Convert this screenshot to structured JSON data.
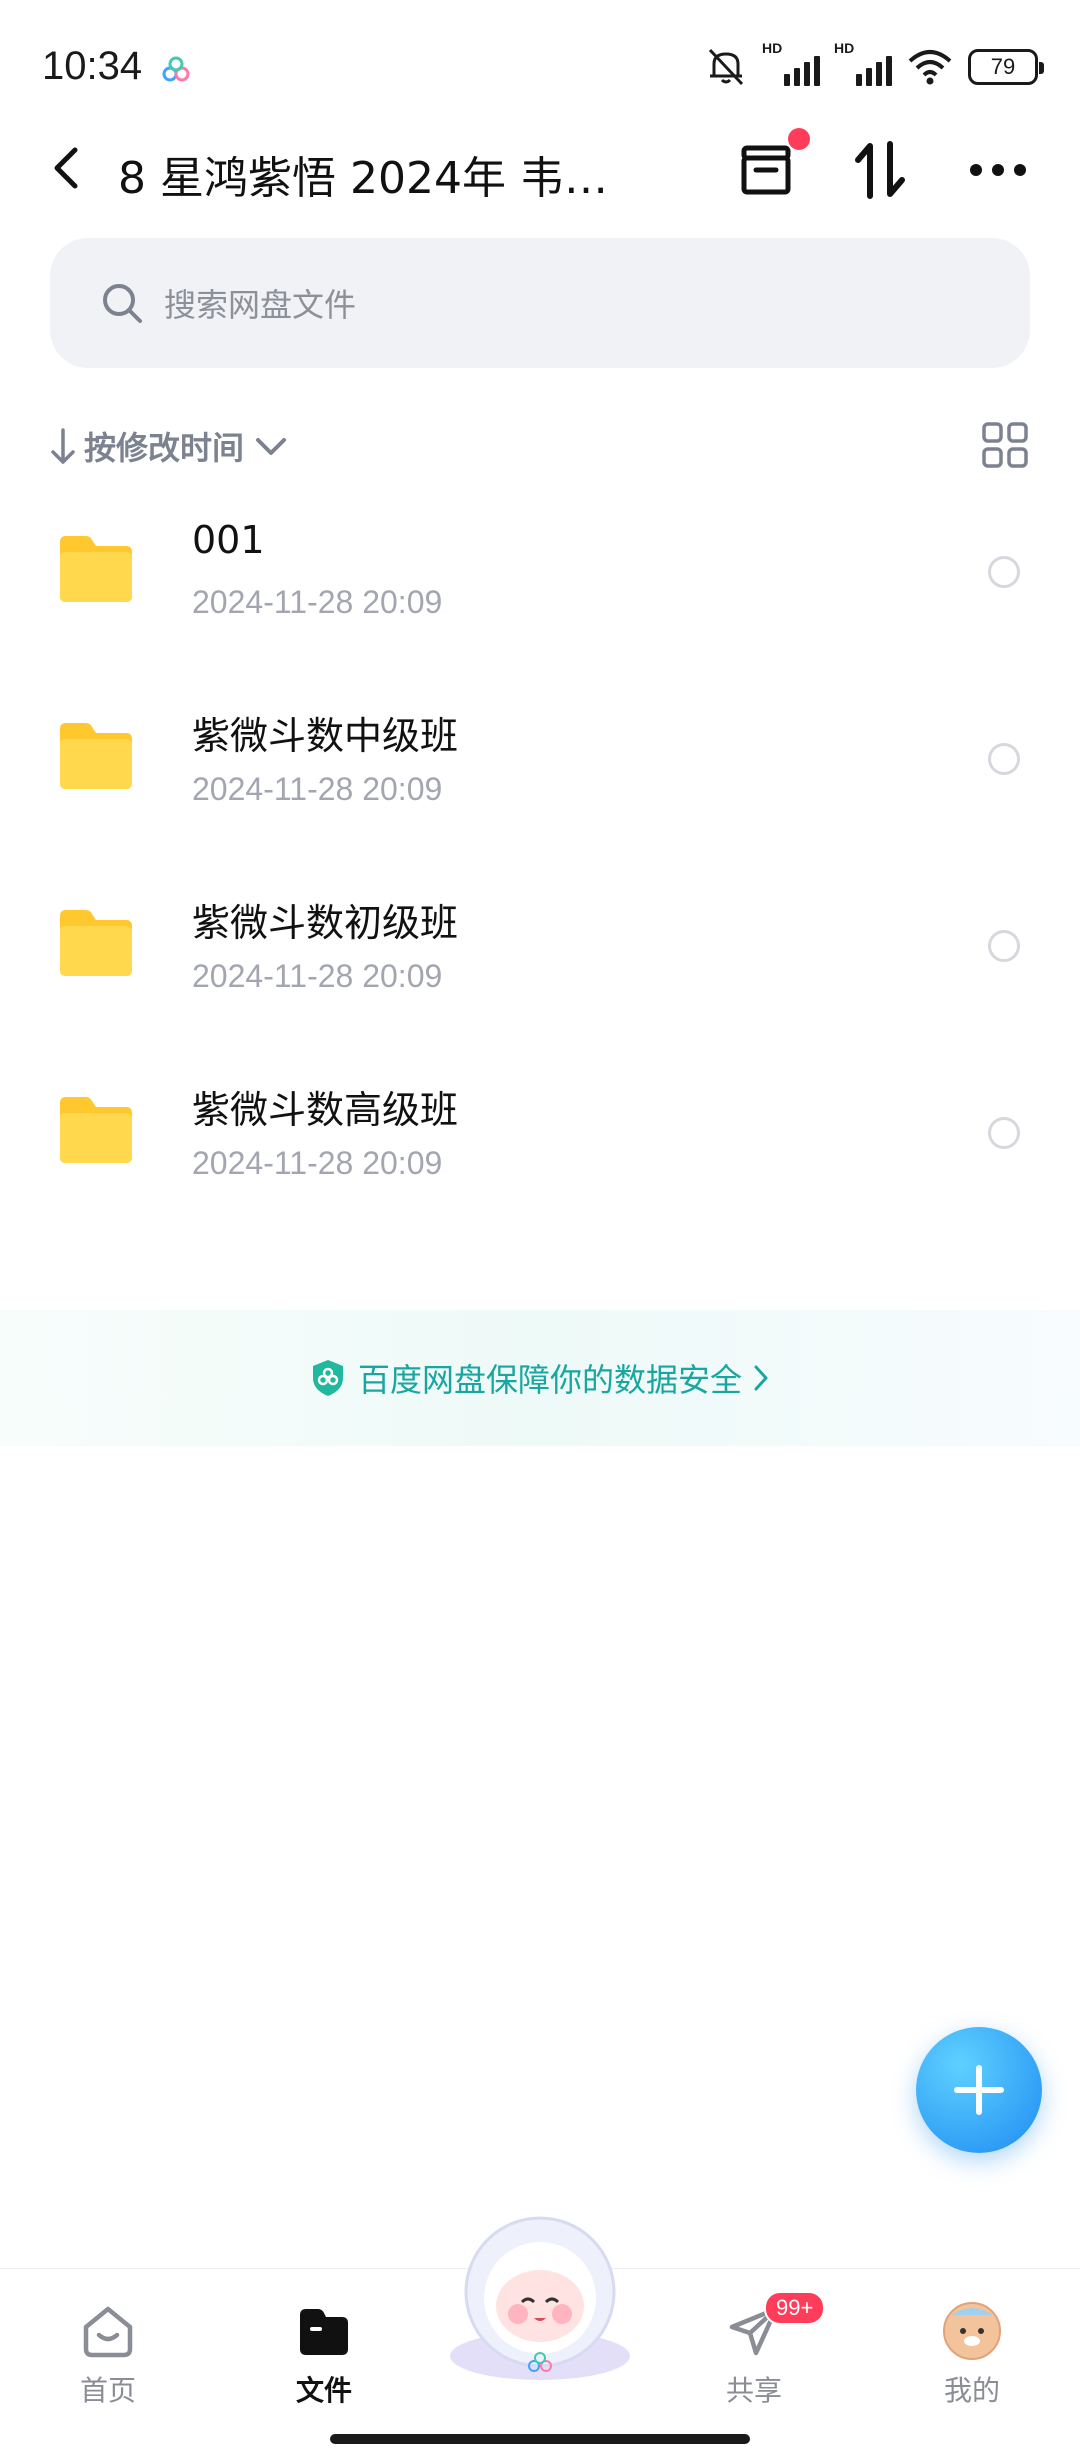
{
  "status_bar": {
    "time": "10:34",
    "hd1": "HD",
    "hd2": "HD",
    "battery": "79"
  },
  "header": {
    "title": "8 星鸿紫悟 2024年 韦老…"
  },
  "search": {
    "placeholder": "搜索网盘文件"
  },
  "sort": {
    "label": "按修改时间"
  },
  "files": [
    {
      "name": "001",
      "date": "2024-11-28  20:09"
    },
    {
      "name": "紫微斗数中级班",
      "date": "2024-11-28  20:09"
    },
    {
      "name": "紫微斗数初级班",
      "date": "2024-11-28  20:09"
    },
    {
      "name": "紫微斗数高级班",
      "date": "2024-11-28  20:09"
    }
  ],
  "security_banner": {
    "text": "百度网盘保障你的数据安全"
  },
  "nav": {
    "items": [
      {
        "label": "首页"
      },
      {
        "label": "文件"
      },
      {
        "label": "共享",
        "badge": "99+"
      },
      {
        "label": "我的"
      }
    ]
  },
  "colors": {
    "accent": "#1e8bf2",
    "badge": "#ff3d5a",
    "folder": "#ffc82e",
    "security": "#1aa6a0"
  },
  "icons": [
    "back-icon",
    "archive-icon",
    "sort-icon",
    "more-icon",
    "search-icon",
    "grid-view-icon",
    "folder-icon",
    "shield-icon",
    "plus-icon",
    "home-icon",
    "files-icon",
    "share-icon",
    "avatar"
  ]
}
